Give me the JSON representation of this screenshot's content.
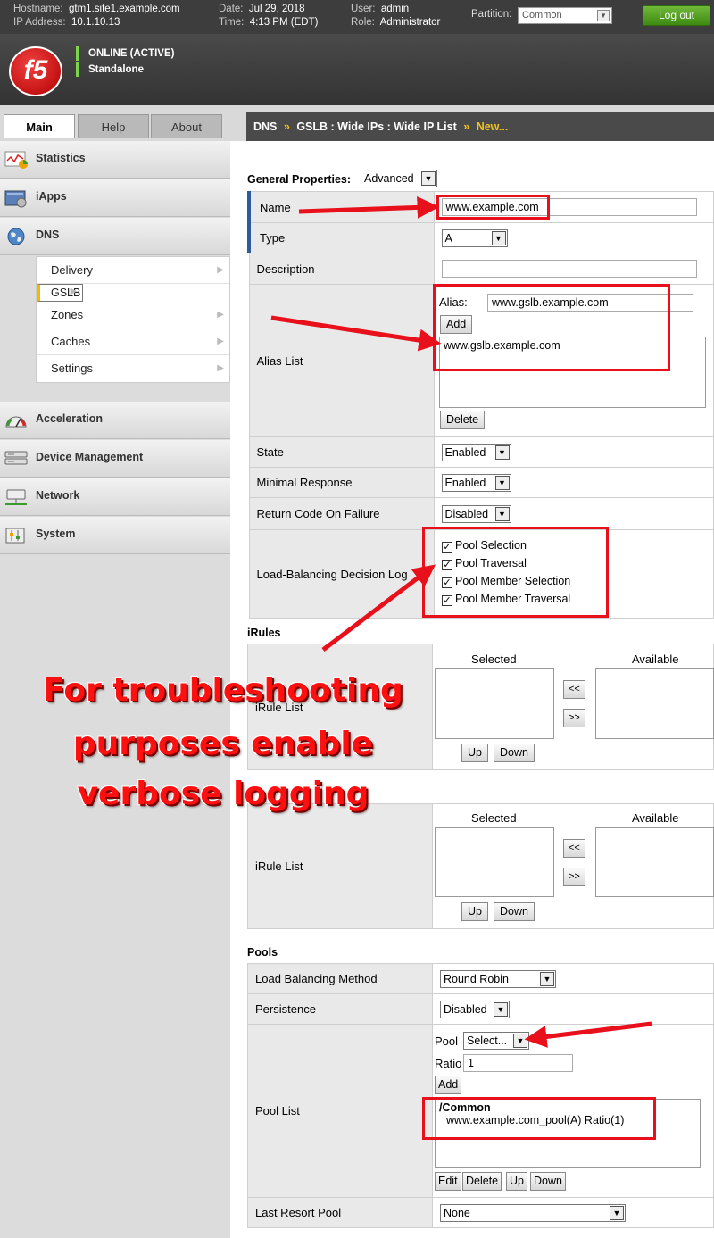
{
  "header": {
    "hostname_label": "Hostname:",
    "hostname": "gtm1.site1.example.com",
    "ip_label": "IP Address:",
    "ip": "10.1.10.13",
    "date_label": "Date:",
    "date": "Jul 29, 2018",
    "time_label": "Time:",
    "time": "4:13 PM (EDT)",
    "user_label": "User:",
    "user": "admin",
    "role_label": "Role:",
    "role": "Administrator",
    "partition_label": "Partition:",
    "partition": "Common",
    "logout": "Log out",
    "logo": "f5",
    "status_online": "ONLINE (ACTIVE)",
    "status_mode": "Standalone"
  },
  "tabs": [
    "Main",
    "Help",
    "About"
  ],
  "breadcrumb": {
    "dns": "DNS",
    "gslb": "GSLB : Wide IPs : Wide IP List",
    "new": "New...",
    "sep": "»"
  },
  "sidebar": {
    "items": [
      "Statistics",
      "iApps",
      "DNS",
      "Acceleration",
      "Device Management",
      "Network",
      "System"
    ],
    "submenu": [
      "Delivery",
      "GSLB",
      "Zones",
      "Caches",
      "Settings"
    ]
  },
  "general": {
    "title": "General Properties:",
    "mode": "Advanced",
    "name_label": "Name",
    "name_value": "www.example.com",
    "type_label": "Type",
    "type_value": "A",
    "description_label": "Description",
    "alias_list_label": "Alias List",
    "alias_label": "Alias:",
    "alias_value": "www.gslb.example.com",
    "add": "Add",
    "delete": "Delete",
    "alias_entry": "www.gslb.example.com",
    "state_label": "State",
    "state_value": "Enabled",
    "minimal_label": "Minimal Response",
    "minimal_value": "Enabled",
    "rcode_label": "Return Code On Failure",
    "rcode_value": "Disabled",
    "lbdl_label": "Load-Balancing Decision Log",
    "lbdl_options": [
      "Pool Selection",
      "Pool Traversal",
      "Pool Member Selection",
      "Pool Member Traversal"
    ]
  },
  "irules": {
    "title": "iRules",
    "list_label": "iRule List",
    "selected": "Selected",
    "available": "Available",
    "left": "<<",
    "right": ">>",
    "up": "Up",
    "down": "Down"
  },
  "irules2": {
    "list_label": "iRule List",
    "selected": "Selected",
    "available": "Available",
    "left": "<<",
    "right": ">>",
    "up": "Up",
    "down": "Down"
  },
  "pools": {
    "title": "Pools",
    "lb_label": "Load Balancing Method",
    "lb_value": "Round Robin",
    "persistence_label": "Persistence",
    "persistence_value": "Disabled",
    "pool_list_label": "Pool List",
    "pool_label": "Pool",
    "pool_select": "Select...",
    "ratio_label": "Ratio",
    "ratio_value": "1",
    "add": "Add",
    "partition_header": "/Common",
    "pool_entry": "www.example.com_pool(A) Ratio(1)",
    "edit": "Edit",
    "delete": "Delete",
    "up": "Up",
    "down": "Down",
    "last_resort_label": "Last Resort Pool",
    "last_resort_value": "None"
  },
  "annotation": {
    "line1": "For troubleshooting",
    "line2": "purposes enable",
    "line3": "verbose logging"
  },
  "colors": {
    "annotation_red": "#e8101a",
    "online_green": "#7bd44a",
    "crumb_accent": "#f5c518"
  }
}
